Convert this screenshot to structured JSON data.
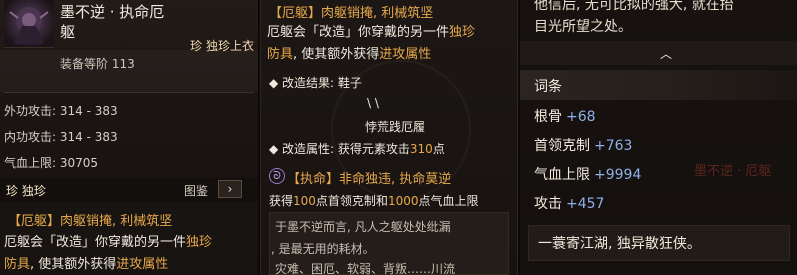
{
  "left": {
    "item_name": "墨不逆 · 执命厄\n躯",
    "rarity_tag": "珍 独珍上衣",
    "equip_level": "装备等阶 113",
    "stats": [
      {
        "label": "外功攻击: 314 - 383"
      },
      {
        "label": "内功攻击: 314 - 383"
      },
      {
        "label": "气血上限: 30705"
      }
    ],
    "rarity": "珍 独珍",
    "codex_label": "图鉴",
    "codex_arrow": "›",
    "effect_title": "【厄躯】肉躯销掩, 利械筑坚",
    "effect_line1_a": "厄躯会「改造」你穿戴的另一件",
    "effect_line1_b": "独珍",
    "effect_line2_a": "防具",
    "effect_line2_b": ", 使其额外获得",
    "effect_line2_c": "进攻属性"
  },
  "middle": {
    "effect_title": "【厄躯】肉躯销掩, 利械筑坚",
    "line1_a": "厄躯会「改造」你穿戴的另一件",
    "line1_b": "独珍",
    "line2_a": "防具",
    "line2_b": ", 使其额外获得",
    "line2_c": "进攻属性",
    "result_label": "◆ 改造结果: 鞋子",
    "arrow_mark": "\\ \\",
    "result_item": "悖荒践厄履",
    "attr_a": "◆ 改造属性: 获得元素攻击",
    "attr_b": "310",
    "attr_c": "点",
    "exclusive_icon": "ᘐ",
    "exclusive_title": "【执命】非命独违, 执命莫逆",
    "exclusive_a": "获得",
    "exclusive_b": "100",
    "exclusive_c": "点首领克制和",
    "exclusive_d": "1000",
    "exclusive_e": "点气血上限",
    "lore1": "于墨不逆而言, 凡人之躯处处纰漏",
    "lore2": ", 是最无用的耗材。",
    "lore3": "灾难、困厄、软弱、背叛……川流"
  },
  "right": {
    "lore_top1": "他信后, 无可比拟的强大, 就在抬",
    "lore_top2": "目光所望之处。",
    "collapse_arrow": "︿",
    "affix_title": "词条",
    "affixes": [
      {
        "name": "根骨",
        "value": "+68"
      },
      {
        "name": "首领克制",
        "value": "+763"
      },
      {
        "name": "气血上限",
        "value": "+9994"
      },
      {
        "name": "攻击",
        "value": "+457"
      }
    ],
    "ghost_name": "墨不逆 · 厄躯",
    "motto": "一蓑寄江湖, 独异散狂侠。"
  },
  "colors": {
    "accent_gold": "#e7a84b",
    "value_blue": "#8fb0e8"
  }
}
